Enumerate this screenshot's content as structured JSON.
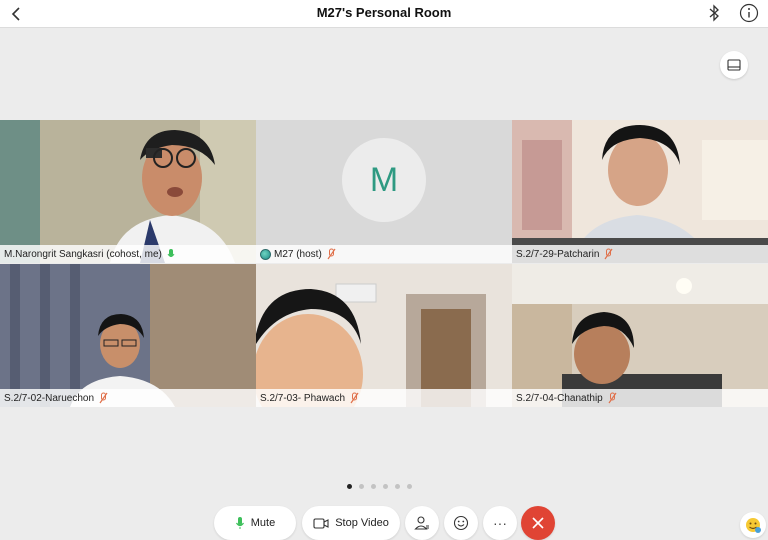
{
  "header": {
    "title": "M27's Personal Room"
  },
  "participants": [
    {
      "name": "M.Narongrit Sangkasri (cohost, me)",
      "mic": "on",
      "active": true
    },
    {
      "name": "M27 (host)",
      "mic": "muted",
      "avatar_letter": "M"
    },
    {
      "name": "S.2/7-29-Patcharin",
      "mic": "muted"
    },
    {
      "name": "S.2/7-02-Naruechon",
      "mic": "muted"
    },
    {
      "name": "S.2/7-03- Phawach",
      "mic": "muted"
    },
    {
      "name": "S.2/7-04-Chanathip",
      "mic": "muted"
    }
  ],
  "pager": {
    "pages": 6,
    "current": 1
  },
  "toolbar": {
    "mute_label": "Mute",
    "stop_video_label": "Stop Video",
    "more_label": "···"
  },
  "colors": {
    "accent": "#2aa7c9",
    "end": "#e04434",
    "mic_on": "#3cbf5a",
    "mic_muted": "#e0704a"
  }
}
